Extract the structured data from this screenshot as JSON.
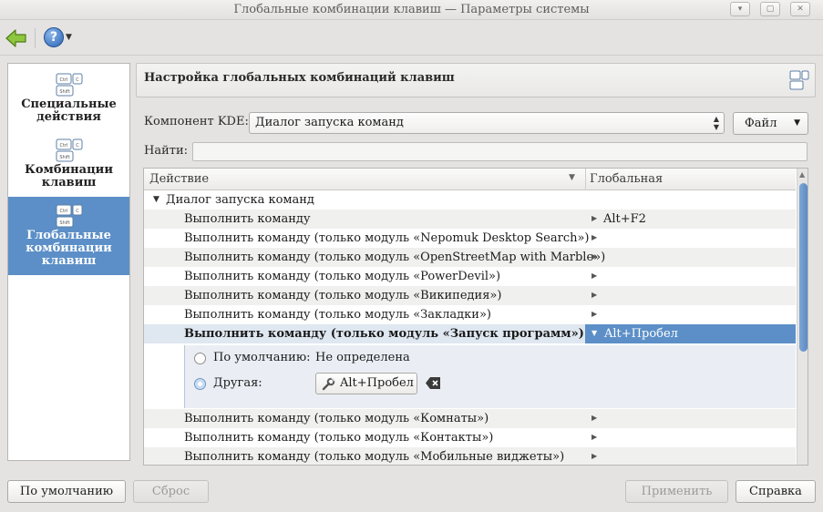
{
  "window": {
    "title": "Глобальные комбинации клавиш — Параметры системы",
    "buttons": [
      "▾",
      "▢",
      "✕"
    ]
  },
  "toolbar": {
    "help_label": "?"
  },
  "sidebar": {
    "items": [
      {
        "label_line1": "Специальные",
        "label_line2": "действия",
        "label_line3": ""
      },
      {
        "label_line1": "Комбинации",
        "label_line2": "клавиш",
        "label_line3": ""
      },
      {
        "label_line1": "Глобальные",
        "label_line2": "комбинации",
        "label_line3": "клавиш"
      }
    ],
    "icon_keys": [
      "Ctrl",
      "C",
      "Shift"
    ]
  },
  "panel": {
    "title": "Настройка глобальных комбинаций клавиш",
    "component_label": "Компонент KDE:",
    "component_value": "Диалог запуска команд",
    "file_button": "Файл",
    "search_label": "Найти:"
  },
  "table": {
    "columns": [
      "Действие",
      "Глобальная"
    ],
    "group": "Диалог запуска команд",
    "rows": [
      {
        "name": "Выполнить команду",
        "shortcut": "Alt+F2"
      },
      {
        "name": "Выполнить команду (только модуль «Nepomuk Desktop Search»)",
        "shortcut": ""
      },
      {
        "name": "Выполнить команду (только модуль «OpenStreetMap with Marble»)",
        "shortcut": ""
      },
      {
        "name": "Выполнить команду (только модуль «PowerDevil»)",
        "shortcut": ""
      },
      {
        "name": "Выполнить команду (только модуль «Википедия»)",
        "shortcut": ""
      },
      {
        "name": "Выполнить команду (только модуль «Закладки»)",
        "shortcut": ""
      },
      {
        "name": "Выполнить команду (только модуль «Запуск программ»)",
        "shortcut": "Alt+Пробел"
      },
      {
        "name": "Выполнить команду (только модуль «Комнаты»)",
        "shortcut": ""
      },
      {
        "name": "Выполнить команду (только модуль «Контакты»)",
        "shortcut": ""
      },
      {
        "name": "Выполнить команду (только модуль «Мобильные виджеты»)",
        "shortcut": ""
      }
    ],
    "editor": {
      "default_label": "По умолчанию:",
      "default_value": "Не определена",
      "custom_label": "Другая:",
      "custom_value": "Alt+Пробел"
    }
  },
  "footer": {
    "defaults": "По умолчанию",
    "reset": "Сброс",
    "apply": "Применить",
    "help": "Справка"
  },
  "colors": {
    "accent": "#5c8fc7",
    "window_bg": "#e4e3e1"
  }
}
